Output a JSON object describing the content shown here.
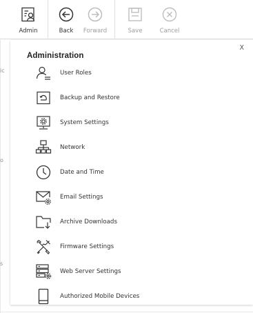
{
  "toolbar": {
    "admin_label": "Admin",
    "back_label": "Back",
    "forward_label": "Forward",
    "save_label": "Save",
    "cancel_label": "Cancel"
  },
  "background": {
    "edge_chars": [
      "ic",
      "o",
      "s"
    ]
  },
  "panel": {
    "title": "Administration",
    "close_label": "X",
    "items": [
      {
        "label": "User Roles",
        "icon": "user-roles-icon"
      },
      {
        "label": "Backup and Restore",
        "icon": "backup-icon"
      },
      {
        "label": "System Settings",
        "icon": "system-settings-icon"
      },
      {
        "label": "Network",
        "icon": "network-icon"
      },
      {
        "label": "Date and Time",
        "icon": "clock-icon"
      },
      {
        "label": "Email Settings",
        "icon": "email-settings-icon"
      },
      {
        "label": "Archive Downloads",
        "icon": "archive-downloads-icon"
      },
      {
        "label": "Firmware Settings",
        "icon": "firmware-icon"
      },
      {
        "label": "Web Server Settings",
        "icon": "web-server-icon"
      },
      {
        "label": "Authorized Mobile Devices",
        "icon": "mobile-device-icon"
      }
    ]
  },
  "colors": {
    "icon_dark": "#333333",
    "icon_disabled": "#bdbdbd",
    "text": "#333333",
    "disabled_text": "#9d9d9d"
  }
}
